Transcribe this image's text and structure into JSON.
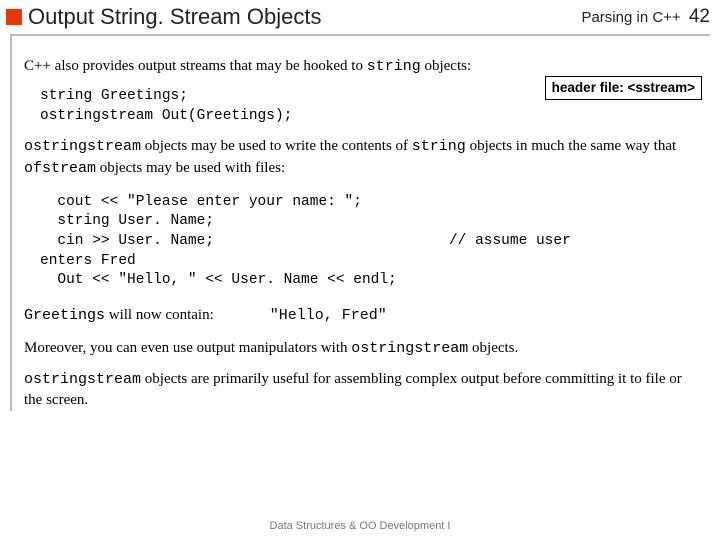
{
  "header": {
    "title": "Output String. Stream Objects",
    "course": "Parsing in C++",
    "page": "42"
  },
  "intro": {
    "pre": "C++ also provides output streams that may be hooked to ",
    "code": "string",
    "post": " objects:"
  },
  "decl_code": "string Greetings;\nostringstream Out(Greetings);",
  "headerfile": "header file: <sstream>",
  "para2": {
    "c1": "ostringstream",
    "t1": " objects may be used to write the contents of ",
    "c2": "string",
    "t2": " objects in much the same way that ",
    "c3": "ofstream",
    "t3": " objects may be used with files:"
  },
  "example_code": "  cout << \"Please enter your name: \";\n  string User. Name;\n  cin >> User. Name;                           // assume user\nenters Fred\n  Out << \"Hello, \" << User. Name << endl;",
  "willcontain": {
    "code": "Greetings",
    "text": " will now contain:",
    "value": "\"Hello, Fred\""
  },
  "para3": {
    "t1": "Moreover, you can even use output manipulators with ",
    "c1": "ostringstream",
    "t2": " objects."
  },
  "para4": {
    "c1": "ostringstream",
    "t1": " objects are primarily useful for assembling complex output before committing it to file or the screen."
  },
  "footer": "Data Structures & OO Development I"
}
